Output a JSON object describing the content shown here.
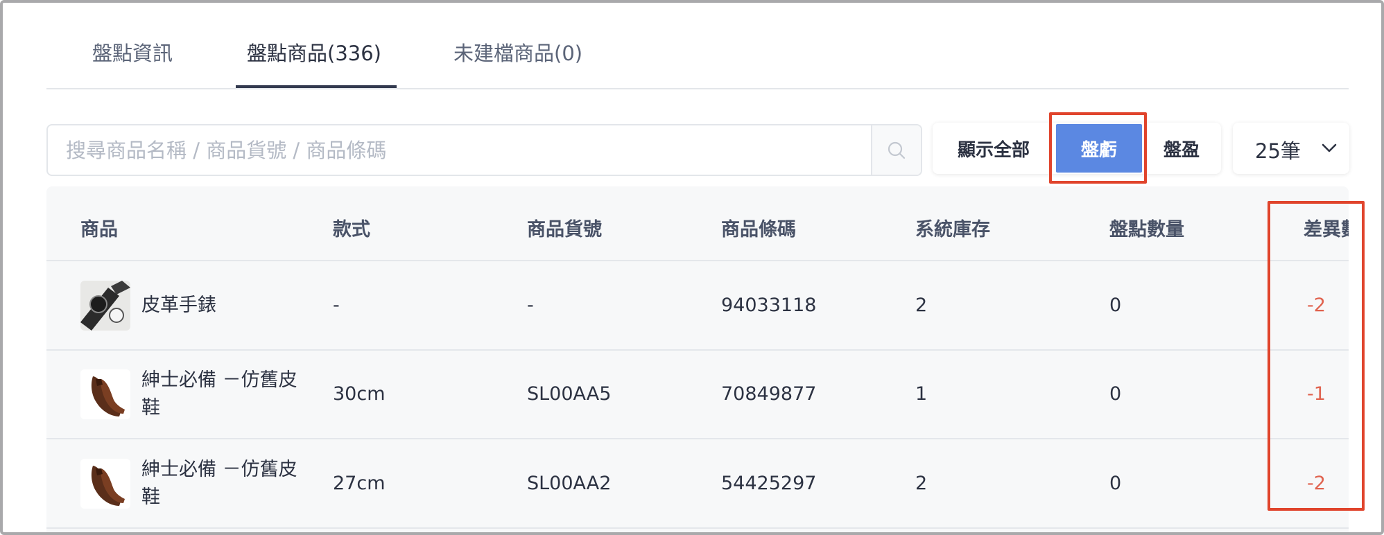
{
  "tabs": [
    {
      "label": "盤點資訊",
      "active": false
    },
    {
      "label": "盤點商品(336)",
      "active": true
    },
    {
      "label": "未建檔商品(0)",
      "active": false
    }
  ],
  "search": {
    "placeholder": "搜尋商品名稱 / 商品貨號 / 商品條碼",
    "value": "",
    "icon": "search-icon"
  },
  "filters": {
    "show_all": "顯示全部",
    "loss": "盤虧",
    "gain": "盤盈",
    "active": "盤虧"
  },
  "page_size": {
    "value": "25筆",
    "icon": "chevron-down-icon"
  },
  "table": {
    "columns": [
      "商品",
      "款式",
      "商品貨號",
      "商品條碼",
      "系統庫存",
      "盤點數量",
      "差異數"
    ],
    "rows": [
      {
        "name": "皮革手錶",
        "name_line1": "皮革手錶",
        "name_line2": "",
        "style": "-",
        "sku": "-",
        "barcode": "94033118",
        "system_stock": "2",
        "counted": "0",
        "diff": "-2",
        "image": "watch-image"
      },
      {
        "name": "紳士必備 －仿舊皮鞋",
        "name_line1": "紳士必備 －仿舊皮",
        "name_line2": "鞋",
        "style": "30cm",
        "sku": "SL00AA5",
        "barcode": "70849877",
        "system_stock": "1",
        "counted": "0",
        "diff": "-1",
        "image": "shoe-image"
      },
      {
        "name": "紳士必備 －仿舊皮鞋",
        "name_line1": "紳士必備 －仿舊皮",
        "name_line2": "鞋",
        "style": "27cm",
        "sku": "SL00AA2",
        "barcode": "54425297",
        "system_stock": "2",
        "counted": "0",
        "diff": "-2",
        "image": "shoe-image"
      }
    ]
  },
  "colors": {
    "accent": "#5b88e2",
    "highlight": "#e0442c",
    "negative": "#e0624e"
  }
}
